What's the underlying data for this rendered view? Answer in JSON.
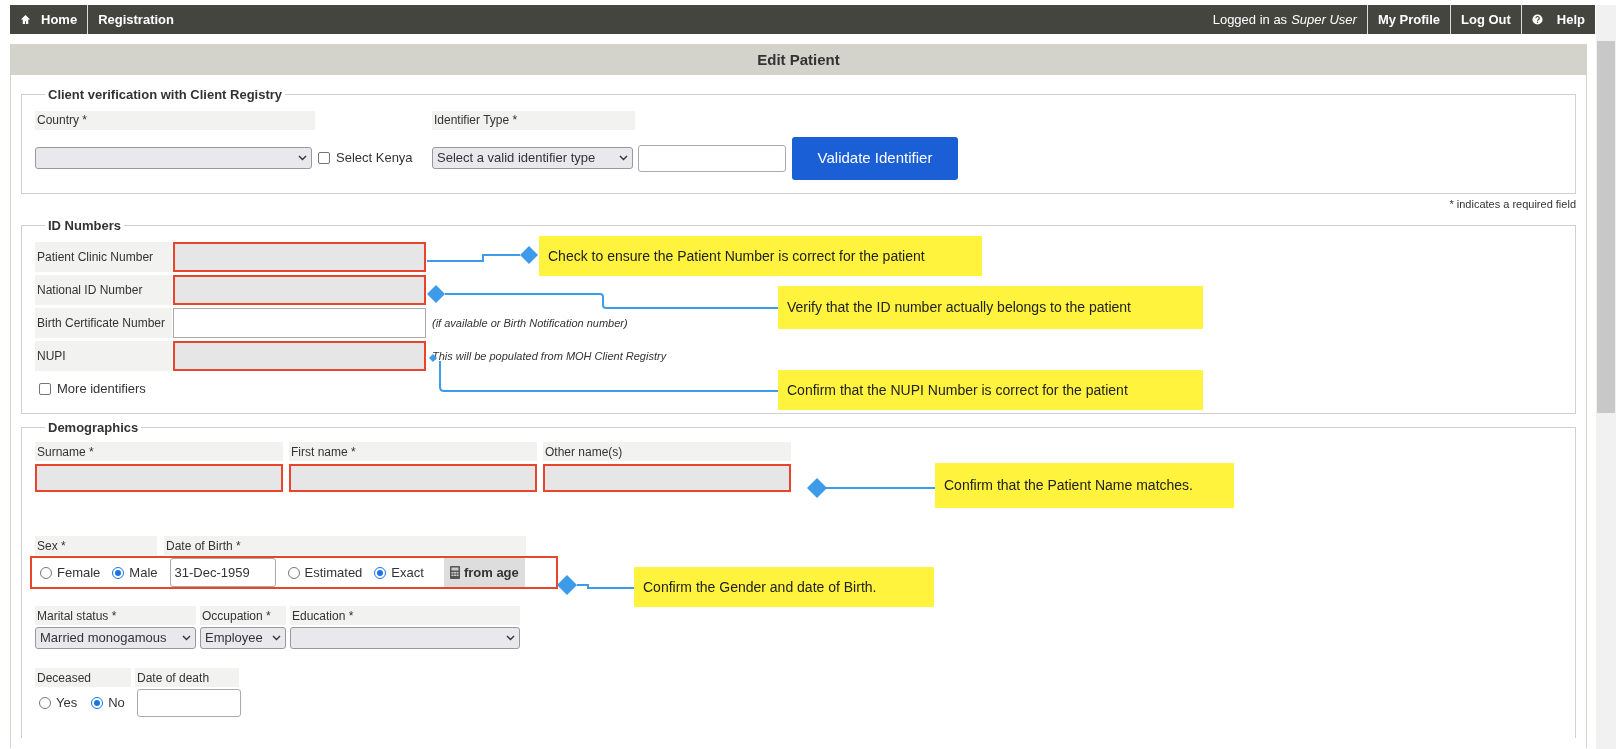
{
  "nav": {
    "left": [
      {
        "kind": "home",
        "label": "Home"
      },
      {
        "kind": "link",
        "label": "Registration"
      }
    ],
    "user_prefix": "Logged in as",
    "user_name": "Super User",
    "right": [
      {
        "kind": "link",
        "label": "My Profile"
      },
      {
        "kind": "link",
        "label": "Log Out"
      },
      {
        "kind": "help",
        "label": "Help"
      }
    ]
  },
  "panel_title": "Edit Patient",
  "client_verification": {
    "legend": "Client verification with Client Registry",
    "country_label": "Country *",
    "select_kenya": {
      "label": "Select Kenya",
      "checked": false
    },
    "identifier_type_label": "Identifier Type *",
    "identifier_type_value": "Select a valid identifier type",
    "button": "Validate Identifier"
  },
  "required_note": "* indicates a required field",
  "id_numbers": {
    "legend": "ID Numbers",
    "rows": [
      {
        "label": "Patient Clinic Number",
        "disabled": true,
        "highlighted": true
      },
      {
        "label": "National ID Number",
        "disabled": true,
        "highlighted": true
      },
      {
        "label": "Birth Certificate Number",
        "disabled": false,
        "highlighted": false,
        "hint": "(if available or Birth Notification number)"
      },
      {
        "label": "NUPI",
        "disabled": true,
        "highlighted": true,
        "hint": "This will be populated from MOH Client Registry"
      }
    ],
    "more_identifiers": {
      "label": "More identifiers",
      "checked": false
    }
  },
  "demographics": {
    "legend": "Demographics",
    "names": [
      {
        "label": "Surname *",
        "disabled": true,
        "highlighted": true
      },
      {
        "label": "First name *",
        "disabled": true,
        "highlighted": true
      },
      {
        "label": "Other name(s)",
        "disabled": true,
        "highlighted": true
      }
    ],
    "sex_dob_highlighted": true,
    "sex": {
      "label": "Sex *",
      "options": [
        {
          "label": "Female",
          "selected": false
        },
        {
          "label": "Male",
          "selected": true
        }
      ]
    },
    "dob": {
      "label": "Date of Birth *",
      "value": "31-Dec-1959",
      "accuracy": [
        {
          "label": "Estimated",
          "selected": false
        },
        {
          "label": "Exact",
          "selected": true
        }
      ],
      "from_age": "from age"
    },
    "selects": [
      {
        "label": "Marital status *",
        "value": "Married monogamous"
      },
      {
        "label": "Occupation *",
        "value": "Employee"
      },
      {
        "label": "Education *"
      }
    ],
    "deceased": {
      "label": "Deceased",
      "options": [
        {
          "label": "Yes",
          "selected": false
        },
        {
          "label": "No",
          "selected": true
        }
      ]
    },
    "date_of_death_label": "Date of death"
  },
  "notes": [
    {
      "text": "Check to ensure the Patient Number is correct for the patient"
    },
    {
      "text": "Verify that the ID number actually belongs to the patient"
    },
    {
      "text": "Confirm that the NUPI Number is correct for the patient"
    },
    {
      "text": "Confirm that the Patient Name matches."
    },
    {
      "text": "Confirm the Gender and date of Birth."
    }
  ]
}
